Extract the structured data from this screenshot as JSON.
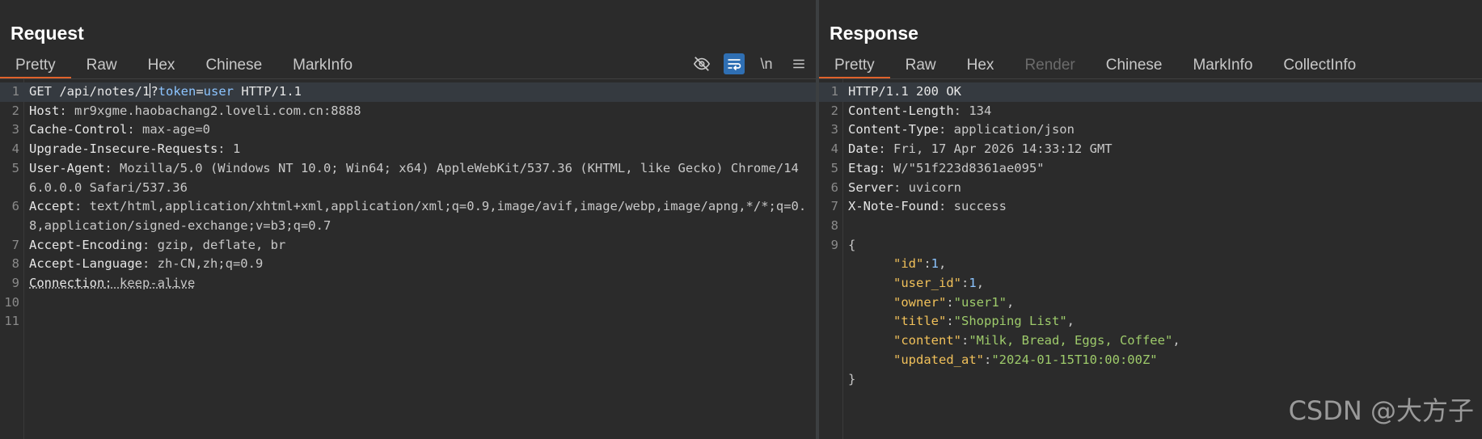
{
  "request": {
    "title": "Request",
    "tabs": [
      "Pretty",
      "Raw",
      "Hex",
      "Chinese",
      "MarkInfo"
    ],
    "active_tab": "Pretty",
    "toolbar": [
      "eye-off-icon",
      "wrap-icon",
      "\\n",
      "menu-icon"
    ],
    "lines": {
      "l1": {
        "method": "GET /api/notes/1",
        "rest": "?",
        "param_key": "token",
        "eq": "=",
        "param_val": "user",
        "proto": " HTTP/1.1"
      },
      "l2": {
        "k": "Host",
        "v": ": mr9xgme.haobachang2.loveli.com.cn:8888"
      },
      "l3": {
        "k": "Cache-Control",
        "v": ": max-age=0"
      },
      "l4": {
        "k": "Upgrade-Insecure-Requests",
        "v": ": 1"
      },
      "l5": {
        "k": "User-Agent",
        "v": ": Mozilla/5.0 (Windows NT 10.0; Win64; x64) AppleWebKit/537.36 (KHTML, like Gecko) Chrome/146.0.0.0 Safari/537.36"
      },
      "l6": {
        "k": "Accept",
        "v": ": text/html,application/xhtml+xml,application/xml;q=0.9,image/avif,image/webp,image/apng,*/*;q=0.8,application/signed-exchange;v=b3;q=0.7"
      },
      "l7": {
        "k": "Accept-Encoding",
        "v": ": gzip, deflate, br"
      },
      "l8": {
        "k": "Accept-Language",
        "v": ": zh-CN,zh;q=0.9"
      },
      "l9": {
        "k": "Connection",
        "v": ": keep-alive"
      }
    }
  },
  "response": {
    "title": "Response",
    "tabs": [
      "Pretty",
      "Raw",
      "Hex",
      "Render",
      "Chinese",
      "MarkInfo",
      "CollectInfo"
    ],
    "active_tab": "Pretty",
    "disabled_tab": "Render",
    "lines": {
      "l1": "HTTP/1.1 200 OK",
      "l2": {
        "k": "Content-Length",
        "v": ": 134"
      },
      "l3": {
        "k": "Content-Type",
        "v": ": application/json"
      },
      "l4": {
        "k": "Date",
        "v": ": Fri, 17 Apr 2026 14:33:12 GMT"
      },
      "l5": {
        "k": "Etag",
        "v": ": W/\"51f223d8361ae095\""
      },
      "l6": {
        "k": "Server",
        "v": ": uvicorn"
      },
      "l7": {
        "k": "X-Note-Found",
        "v": ": success"
      }
    },
    "json": {
      "open": "{",
      "close": "}",
      "id_k": "\"id\"",
      "id_v": "1",
      "user_id_k": "\"user_id\"",
      "user_id_v": "1",
      "owner_k": "\"owner\"",
      "owner_v": "\"user1\"",
      "title_k": "\"title\"",
      "title_v": "\"Shopping List\"",
      "content_k": "\"content\"",
      "content_v": "\"Milk, Bread, Eggs, Coffee\"",
      "updated_k": "\"updated_at\"",
      "updated_v": "\"2024-01-15T10:00:00Z\""
    }
  },
  "watermark": "CSDN @大方子"
}
